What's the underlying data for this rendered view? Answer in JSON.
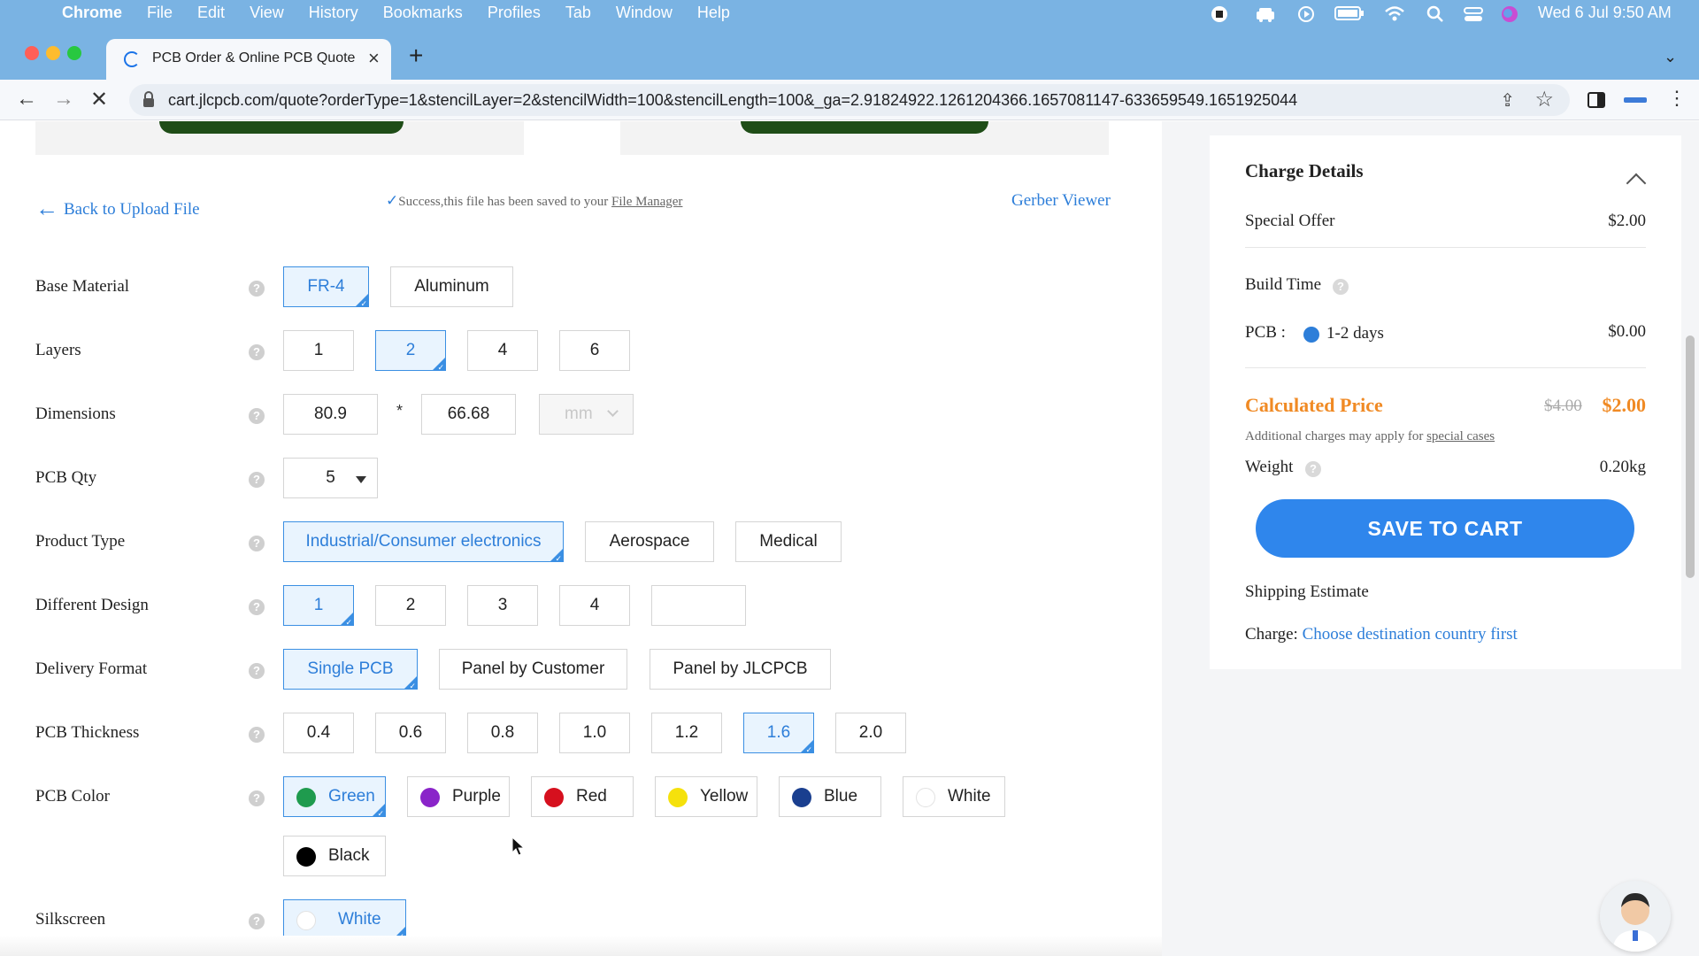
{
  "menubar": {
    "app_name": "Chrome",
    "menus": [
      "File",
      "Edit",
      "View",
      "History",
      "Bookmarks",
      "Profiles",
      "Tab",
      "Window",
      "Help"
    ],
    "clock": "Wed 6 Jul  9:50 AM"
  },
  "browser": {
    "tab_title": "PCB Order & Online PCB Quote",
    "url": "cart.jlcpcb.com/quote?orderType=1&stencilLayer=2&stencilWidth=100&stencilLength=100&_ga=2.91824922.1261204366.1657081147-633659549.1651925044"
  },
  "page": {
    "back_link": "Back to Upload File",
    "success_text": "Success,this file has been saved to your ",
    "file_manager_link": "File Manager",
    "gerber_viewer": "Gerber Viewer",
    "rows": {
      "base_material": {
        "label": "Base Material",
        "options": [
          "FR-4",
          "Aluminum"
        ],
        "selected": "FR-4"
      },
      "layers": {
        "label": "Layers",
        "options": [
          "1",
          "2",
          "4",
          "6"
        ],
        "selected": "2"
      },
      "dimensions": {
        "label": "Dimensions",
        "width": "80.9",
        "separator": "*",
        "length": "66.68",
        "unit": "mm"
      },
      "pcb_qty": {
        "label": "PCB Qty",
        "value": "5"
      },
      "product_type": {
        "label": "Product Type",
        "options": [
          "Industrial/Consumer electronics",
          "Aerospace",
          "Medical"
        ],
        "selected": "Industrial/Consumer electronics"
      },
      "different_design": {
        "label": "Different Design",
        "options": [
          "1",
          "2",
          "3",
          "4"
        ],
        "custom_value": "",
        "selected": "1"
      },
      "delivery_format": {
        "label": "Delivery Format",
        "options": [
          "Single PCB",
          "Panel by Customer",
          "Panel by JLCPCB"
        ],
        "selected": "Single PCB"
      },
      "pcb_thickness": {
        "label": "PCB Thickness",
        "options": [
          "0.4",
          "0.6",
          "0.8",
          "1.0",
          "1.2",
          "1.6",
          "2.0"
        ],
        "selected": "1.6"
      },
      "pcb_color": {
        "label": "PCB Color",
        "options": [
          {
            "label": "Green",
            "color": "#1f9b4e"
          },
          {
            "label": "Purple",
            "color": "#8a24c9"
          },
          {
            "label": "Red",
            "color": "#d6101e"
          },
          {
            "label": "Yellow",
            "color": "#f5e10c"
          },
          {
            "label": "Blue",
            "color": "#1a3f8f"
          },
          {
            "label": "White",
            "color": "#ffffff"
          },
          {
            "label": "Black",
            "color": "#000000"
          }
        ],
        "selected": "Green"
      },
      "silkscreen": {
        "label": "Silkscreen",
        "options": [
          {
            "label": "White",
            "color": "#ffffff"
          }
        ],
        "selected": "White"
      }
    }
  },
  "charge_details": {
    "title": "Charge Details",
    "special_offer_label": "Special Offer",
    "special_offer_value": "$2.00",
    "build_time_label": "Build Time",
    "pcb_label": "PCB :",
    "build_option": "1-2 days",
    "build_price": "$0.00",
    "calculated_price_label": "Calculated Price",
    "old_price": "$4.00",
    "new_price": "$2.00",
    "additional_note": "Additional charges may apply for ",
    "special_cases_link": "special cases",
    "weight_label": "Weight",
    "weight_value": "0.20kg",
    "save_button": "SAVE TO CART",
    "shipping_label": "Shipping Estimate",
    "charge_label": "Charge:",
    "charge_link": "Choose destination country first"
  },
  "colors": {
    "accent": "#2d7ed9",
    "price_orange": "#f08a24",
    "button_blue": "#2f86ec"
  }
}
